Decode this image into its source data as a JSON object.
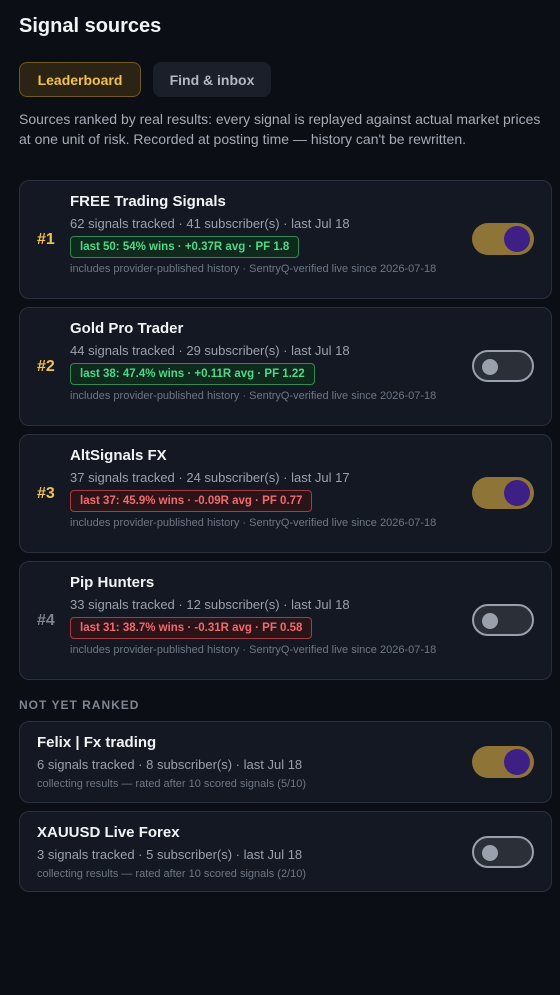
{
  "header": {
    "title": "Signal sources"
  },
  "tabs": {
    "leaderboard": "Leaderboard",
    "find_inbox": "Find & inbox"
  },
  "intro": "Sources ranked by real results: every signal is replayed against actual market prices at one unit of risk. Recorded at posting time — history can't be rewritten.",
  "ranked": [
    {
      "rank": "#1",
      "name": "FREE Trading Signals",
      "meta": "62 signals tracked · 41 subscriber(s) · last Jul 18",
      "badge": "last 50: 54% wins · +0.37R avg · PF 1.8",
      "note": "includes provider-published history · SentryQ-verified live since 2026-07-18",
      "subscribed": true
    },
    {
      "rank": "#2",
      "name": "Gold Pro Trader",
      "meta": "44 signals tracked · 29 subscriber(s) · last Jul 18",
      "badge": "last 38: 47.4% wins · +0.11R avg · PF 1.22",
      "note": "includes provider-published history · SentryQ-verified live since 2026-07-18",
      "subscribed": false
    },
    {
      "rank": "#3",
      "name": "AltSignals FX",
      "meta": "37 signals tracked · 24 subscriber(s) · last Jul 17",
      "badge": "last 37: 45.9% wins · -0.09R avg · PF 0.77",
      "note": "includes provider-published history · SentryQ-verified live since 2026-07-18",
      "subscribed": true
    },
    {
      "rank": "#4",
      "name": "Pip Hunters",
      "meta": "33 signals tracked · 12 subscriber(s) · last Jul 18",
      "badge": "last 31: 38.7% wins · -0.31R avg · PF 0.58",
      "note": "includes provider-published history · SentryQ-verified live since 2026-07-18",
      "subscribed": false
    }
  ],
  "unranked_label": "NOT YET RANKED",
  "unranked": [
    {
      "name": "Felix | Fx trading",
      "meta": "6 signals tracked · 8 subscriber(s) · last Jul 18",
      "note": "collecting results — rated after 10 scored signals (5/10)",
      "subscribed": true
    },
    {
      "name": "XAUUSD Live Forex",
      "meta": "3 signals tracked · 5 subscriber(s) · last Jul 18",
      "note": "collecting results — rated after 10 scored signals (2/10)",
      "subscribed": false
    }
  ],
  "colors": {
    "accent": "#f2c14e",
    "positive": "#4cd98a",
    "negative": "#f06a6f",
    "toggle_on": "#8f7437",
    "knob_on": "#3e1f86"
  }
}
